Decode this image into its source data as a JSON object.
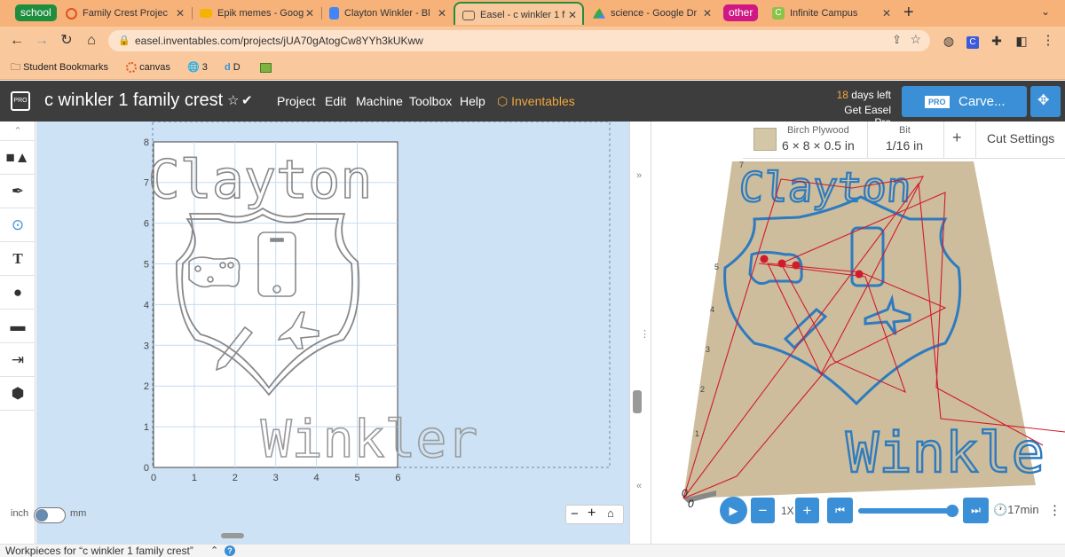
{
  "browser": {
    "tab_groups": [
      {
        "label": "school",
        "color": "#1e8e3e"
      },
      {
        "label": "other",
        "color": "#d01884"
      }
    ],
    "tabs": [
      {
        "title": "Family Crest Projec",
        "fav": "#e0541d",
        "active": false
      },
      {
        "title": "Epik memes - Goog",
        "fav": "#f4b400",
        "active": false
      },
      {
        "title": "Clayton Winkler - Bl",
        "fav": "#4285f4",
        "active": false
      },
      {
        "title": "Easel - c winkler 1 f",
        "fav": "#555555",
        "active": true
      },
      {
        "title": "science - Google Dr",
        "fav": "#34a853",
        "active": false
      },
      {
        "title": "Infinite Campus",
        "fav": "#8bc34a",
        "active": false
      }
    ],
    "new_tab": "+",
    "url": "easel.inventables.com/projects/jUA70gAtogCw8YYh3kUKww",
    "bookmarks": [
      {
        "label": "Student Bookmarks",
        "icon": "folder-icon"
      },
      {
        "label": "canvas",
        "icon": "canvas-icon"
      },
      {
        "label": "3",
        "icon": "globe-icon"
      },
      {
        "label": "D",
        "icon": "d-icon"
      },
      {
        "label": "",
        "icon": "image-icon"
      }
    ]
  },
  "easel": {
    "logo": "PRO",
    "project_title": "c winkler 1 family crest",
    "menu": [
      "Project",
      "Edit",
      "Machine",
      "Toolbox",
      "Help"
    ],
    "inventables": "Inventables",
    "trial_line1_num": "18",
    "trial_line1": "days left",
    "trial_line2": "Get Easel Pro",
    "carve_badge": "PRO",
    "carve_label": "Carve..."
  },
  "canvas": {
    "x_ticks": [
      "0",
      "1",
      "2",
      "3",
      "4",
      "5",
      "6"
    ],
    "y_ticks": [
      "0",
      "1",
      "2",
      "3",
      "4",
      "5",
      "6",
      "7",
      "8"
    ],
    "text_top": "Clayton",
    "text_bottom": "Winkler",
    "unit_left": "inch",
    "unit_right": "mm",
    "zoom_minus": "−",
    "zoom_plus": "+"
  },
  "preview": {
    "material_name": "Birch Plywood",
    "material_size": "6 × 8 × 0.5 in",
    "material_color": "#d3c7a8",
    "bit_label": "Bit",
    "bit_value": "1/16 in",
    "add_label": "+",
    "cut_settings": "Cut Settings",
    "text_top": "Clayton",
    "text_bottom": "Winkle",
    "origin_label": "0",
    "origin_label2": "0",
    "speed": "1X",
    "time": "17min",
    "playback_progress": 0.98
  },
  "footer": {
    "workpieces": "Workpieces for “c winkler 1 family crest”"
  }
}
